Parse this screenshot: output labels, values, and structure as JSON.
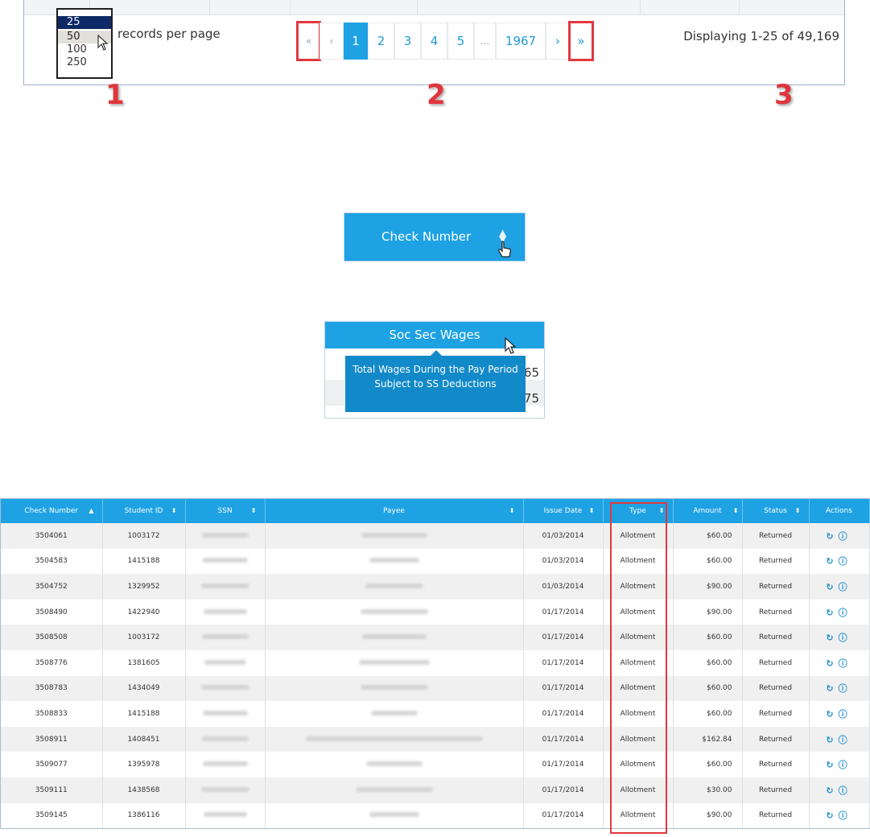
{
  "pagination_panel": {
    "rows_per_page_options": [
      "25",
      "50",
      "100",
      "250"
    ],
    "selected_option": "25",
    "records_per_page_label": "records per page",
    "first_label": "«",
    "prev_label": "‹",
    "pages": [
      "1",
      "2",
      "3",
      "4",
      "5"
    ],
    "ellipsis": "...",
    "last_page": "1967",
    "next_label": "›",
    "last_label": "»",
    "current_page": "1",
    "displaying_text": "Displaying 1-25 of 49,169",
    "callouts": [
      "1",
      "2",
      "3"
    ]
  },
  "sort_header_example": {
    "label": "Check Number",
    "sort_icon": "sort-arrows-icon",
    "cursor": "hand-pointer-icon"
  },
  "tooltip_example": {
    "header": "Soc Sec Wages",
    "tooltip_text": "Total Wages During the Pay Period Subject to SS Deductions",
    "row_values_partial": [
      "65",
      "75"
    ],
    "cursor": "arrow-cursor-icon"
  },
  "checks_table": {
    "columns": [
      "Check Number",
      "Student ID",
      "SSN",
      "Payee",
      "Issue Date",
      "Type",
      "Amount",
      "Status",
      "Actions"
    ],
    "action_icons": [
      "reissue-icon",
      "info-icon"
    ],
    "rows": [
      [
        "3504061",
        "1003172",
        "",
        "",
        "01/03/2014",
        "Allotment",
        "$60.00",
        "Returned"
      ],
      [
        "3504583",
        "1415188",
        "",
        "",
        "01/03/2014",
        "Allotment",
        "$60.00",
        "Returned"
      ],
      [
        "3504752",
        "1329952",
        "",
        "",
        "01/03/2014",
        "Allotment",
        "$90.00",
        "Returned"
      ],
      [
        "3508490",
        "1422940",
        "",
        "",
        "01/17/2014",
        "Allotment",
        "$90.00",
        "Returned"
      ],
      [
        "3508508",
        "1003172",
        "",
        "",
        "01/17/2014",
        "Allotment",
        "$60.00",
        "Returned"
      ],
      [
        "3508776",
        "1381605",
        "",
        "",
        "01/17/2014",
        "Allotment",
        "$60.00",
        "Returned"
      ],
      [
        "3508783",
        "1434049",
        "",
        "",
        "01/17/2014",
        "Allotment",
        "$60.00",
        "Returned"
      ],
      [
        "3508833",
        "1415188",
        "",
        "",
        "01/17/2014",
        "Allotment",
        "$60.00",
        "Returned"
      ],
      [
        "3508911",
        "1408451",
        "",
        "",
        "01/17/2014",
        "Allotment",
        "$162.84",
        "Returned"
      ],
      [
        "3509077",
        "1395978",
        "",
        "",
        "01/17/2014",
        "Allotment",
        "$60.00",
        "Returned"
      ],
      [
        "3509111",
        "1438568",
        "",
        "",
        "01/17/2014",
        "Allotment",
        "$30.00",
        "Returned"
      ],
      [
        "3509145",
        "1386116",
        "",
        "",
        "01/17/2014",
        "Allotment",
        "$90.00",
        "Returned"
      ]
    ]
  }
}
